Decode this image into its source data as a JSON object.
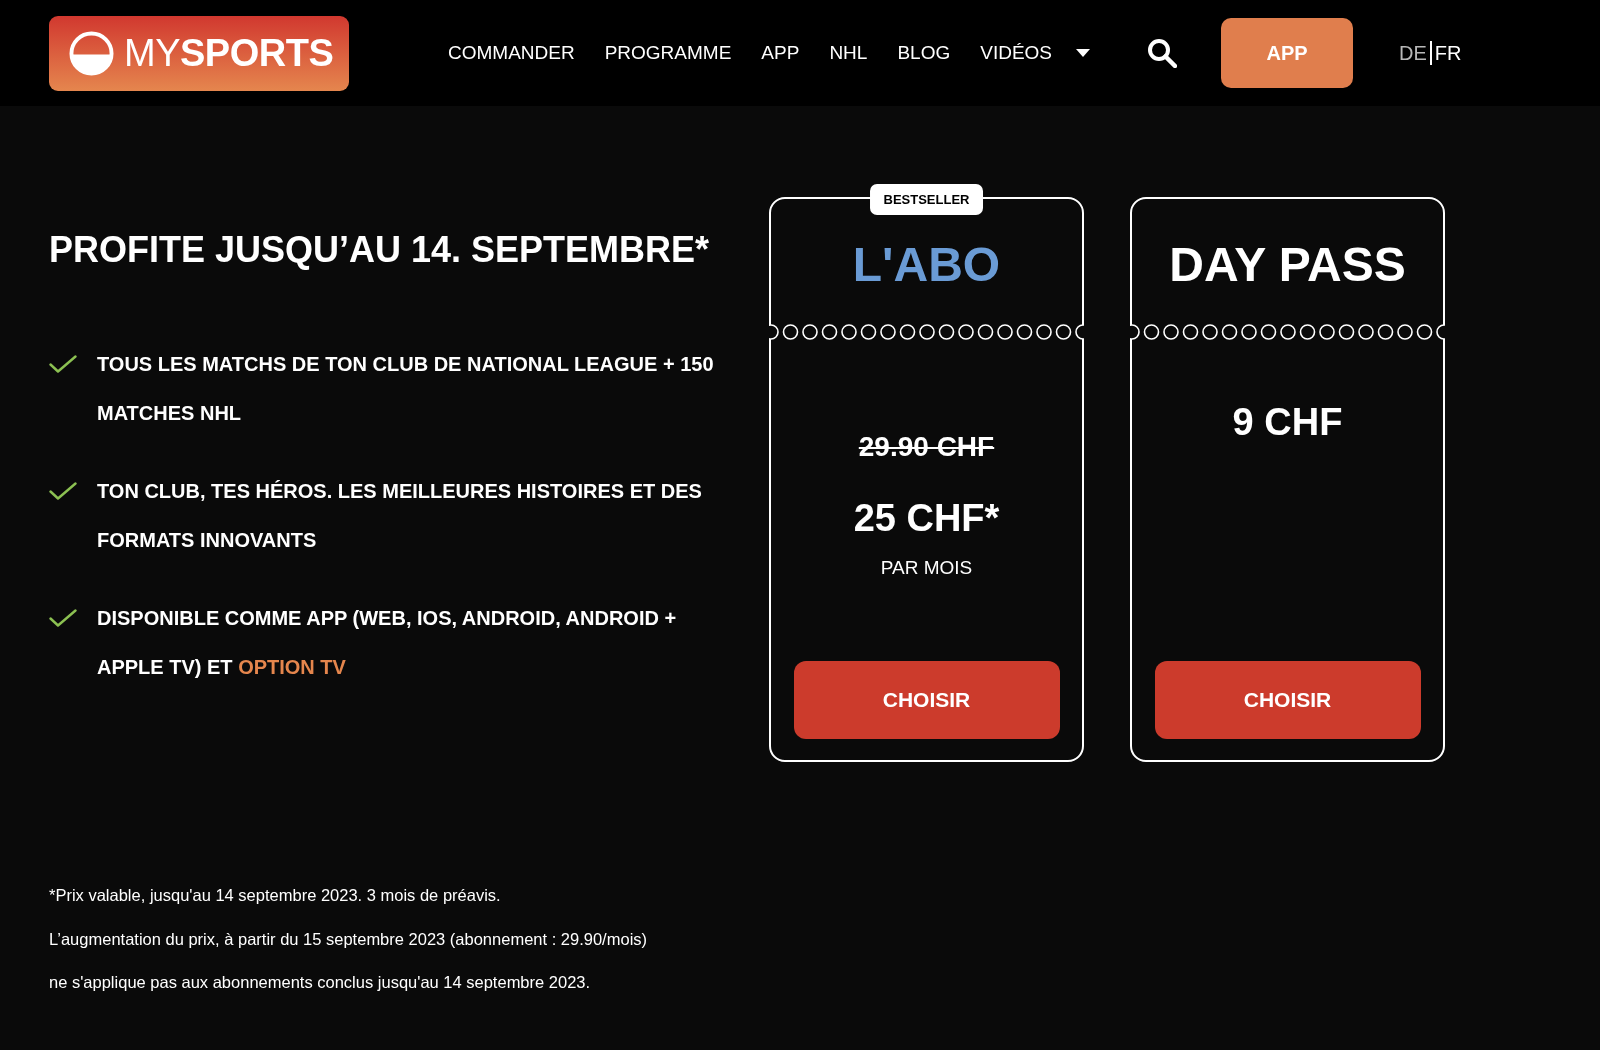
{
  "header": {
    "logo": "MY**SPORTS**",
    "nav": [
      {
        "label": "COMMANDER",
        "kind": "link"
      },
      {
        "label": "PROGRAMME",
        "kind": "link"
      },
      {
        "label": "APP",
        "kind": "link"
      },
      {
        "label": "NHL",
        "kind": "link"
      },
      {
        "label": "BLOG",
        "kind": "link"
      },
      {
        "label": "VIDÉOS",
        "kind": "dropdown"
      }
    ],
    "app_button": "APP",
    "languages": [
      {
        "label": "DE",
        "selected": false
      },
      {
        "label": "FR",
        "selected": true
      }
    ]
  },
  "promo": {
    "headline": "PROFITE JUSQU’AU 14. SEPTEMBRE*",
    "features": [
      {
        "text": "TOUS LES MATCHS DE TON CLUB DE NATIONAL LEAGUE + 150 MATCHES NHL"
      },
      {
        "text": "TON CLUB, TES HÉROS. LES MEILLEURES HISTOIRES ET DES FORMATS INNOVANTS"
      },
      {
        "text": "DISPONIBLE COMME APP (WEB, IOS, ANDROID, ANDROID + APPLE TV) ET",
        "link": "OPTION TV"
      }
    ]
  },
  "plans": [
    {
      "badge": "BESTSELLER",
      "title": "L'ABO",
      "color": "#6a9bd5",
      "old_price": "29.90 CHF",
      "price": "25 CHF*",
      "period": "PAR MOIS",
      "button": "CHOISIR"
    },
    {
      "title": "DAY PASS",
      "color": "#ffffff",
      "price": "9 CHF",
      "button": "CHOISIR"
    }
  ],
  "notes": [
    "*Prix valable, jusqu'au 14 septembre 2023. 3 mois de préavis.",
    "L’augmentation du prix, à partir du 15 septembre 2023 (abonnement : 29.90/mois) ne s'applique pas aux abonnements conclus jusqu'au 14 septembre 2023."
  ]
}
